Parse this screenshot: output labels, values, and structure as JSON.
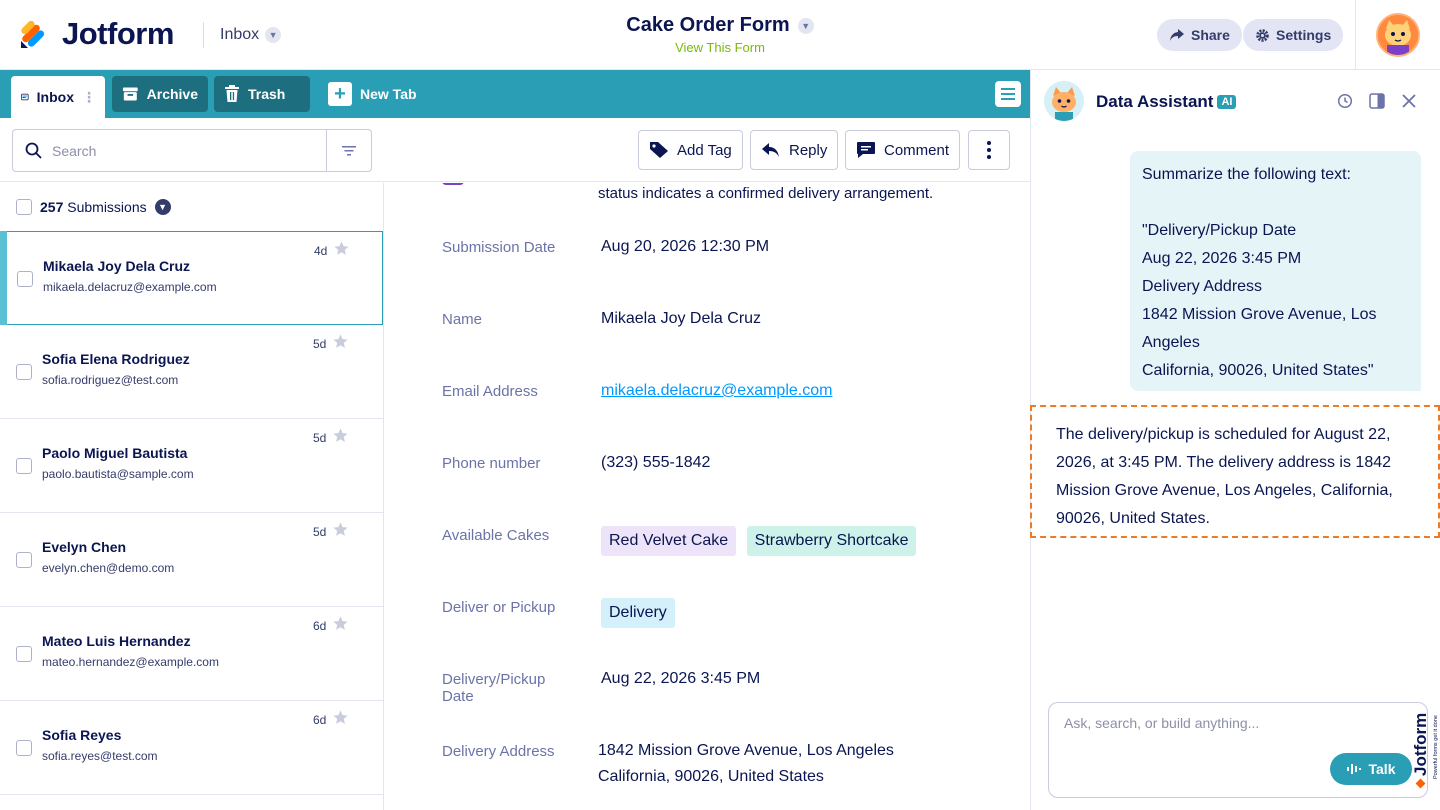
{
  "header": {
    "brand": "Jotform",
    "inbox_dropdown": "Inbox",
    "form_title": "Cake Order Form",
    "form_link": "View This Form",
    "share_label": "Share",
    "settings_label": "Settings"
  },
  "tabs": {
    "inbox": "Inbox",
    "archive": "Archive",
    "trash": "Trash",
    "new_tab": "New Tab"
  },
  "toolbar": {
    "search_placeholder": "Search",
    "add_tag": "Add Tag",
    "reply": "Reply",
    "comment": "Comment"
  },
  "list": {
    "count": "257",
    "count_label": "Submissions",
    "items": [
      {
        "name": "Mikaela Joy Dela Cruz",
        "email": "mikaela.delacruz@example.com",
        "age": "4d"
      },
      {
        "name": "Sofia Elena Rodriguez",
        "email": "sofia.rodriguez@test.com",
        "age": "5d"
      },
      {
        "name": "Paolo Miguel Bautista",
        "email": "paolo.bautista@sample.com",
        "age": "5d"
      },
      {
        "name": "Evelyn Chen",
        "email": "evelyn.chen@demo.com",
        "age": "5d"
      },
      {
        "name": "Mateo Luis Hernandez",
        "email": "mateo.hernandez@example.com",
        "age": "6d"
      },
      {
        "name": "Sofia Reyes",
        "email": "sofia.reyes@test.com",
        "age": "6d"
      }
    ]
  },
  "detail": {
    "status_text": "status indicates a confirmed delivery arrangement.",
    "submission_date_label": "Submission Date",
    "submission_date": "Aug 20, 2026 12:30 PM",
    "name_label": "Name",
    "name": "Mikaela Joy Dela Cruz",
    "email_label": "Email Address",
    "email": "mikaela.delacruz@example.com",
    "phone_label": "Phone number",
    "phone": "(323) 555-1842",
    "cakes_label": "Available Cakes",
    "cakes": [
      "Red Velvet Cake",
      "Strawberry Shortcake"
    ],
    "deliver_label": "Deliver or Pickup",
    "deliver": "Delivery",
    "date_label": "Delivery/Pickup Date",
    "date": "Aug 22, 2026 3:45 PM",
    "address_label": "Delivery Address",
    "address_line1": "1842 Mission Grove Avenue, Los Angeles",
    "address_line2": "California, 90026, United States"
  },
  "assistant": {
    "title": "Data Assistant",
    "badge": "AI",
    "user_message": "Summarize the following text:\n\n\"Delivery/Pickup Date\nAug 22, 2026 3:45 PM\nDelivery Address\n1842 Mission Grove Avenue, Los Angeles\nCalifornia, 90026, United States\"",
    "ai_response": "The delivery/pickup is scheduled for August 22, 2026, at 3:45 PM. The delivery address is 1842 Mission Grove Avenue, Los Angeles, California, 90026, United States.",
    "input_placeholder": "Ask, search, or build anything...",
    "talk_label": "Talk",
    "brand_vertical": "Jotform",
    "brand_tagline": "Powerful forms get it done"
  },
  "colors": {
    "accent": "#2a9eb5",
    "navy": "#0a1551",
    "dashed_highlight": "#ec7a26"
  }
}
